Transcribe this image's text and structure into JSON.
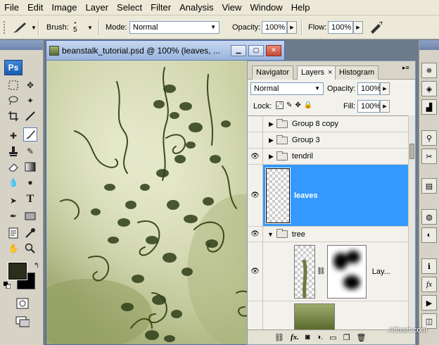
{
  "menu": [
    "File",
    "Edit",
    "Image",
    "Layer",
    "Select",
    "Filter",
    "Analysis",
    "View",
    "Window",
    "Help"
  ],
  "options": {
    "brush_label": "Brush:",
    "brush_size": "5",
    "mode_label": "Mode:",
    "mode_value": "Normal",
    "opacity_label": "Opacity:",
    "opacity_value": "100%",
    "flow_label": "Flow:",
    "flow_value": "100%"
  },
  "toolbox": {
    "logo": "Ps"
  },
  "document": {
    "title": "beanstalk_tutorial.psd @ 100% (leaves, ..."
  },
  "panel": {
    "tabs": [
      "Navigator",
      "Layers",
      "Histogram"
    ],
    "active_tab_close": "×",
    "blend_mode": "Normal",
    "opacity_label": "Opacity:",
    "opacity_value": "100%",
    "lock_label": "Lock:",
    "fill_label": "Fill:",
    "fill_value": "100%"
  },
  "layers": [
    {
      "name": "Group 8 copy",
      "type": "group",
      "visible": false,
      "expanded": false
    },
    {
      "name": "Group 3",
      "type": "group",
      "visible": false,
      "expanded": false
    },
    {
      "name": "tendril",
      "type": "group",
      "visible": true,
      "expanded": false
    },
    {
      "name": "leaves",
      "type": "layer",
      "visible": true,
      "selected": true
    },
    {
      "name": "tree",
      "type": "group",
      "visible": true,
      "expanded": true
    },
    {
      "name": "Lay...",
      "type": "layer",
      "visible": true,
      "has_mask": true
    }
  ],
  "watermark": "Alfoart.com",
  "colors": {
    "selected_layer": "#3399ff",
    "foreground": "#2a2e1a",
    "background": "#000000"
  }
}
